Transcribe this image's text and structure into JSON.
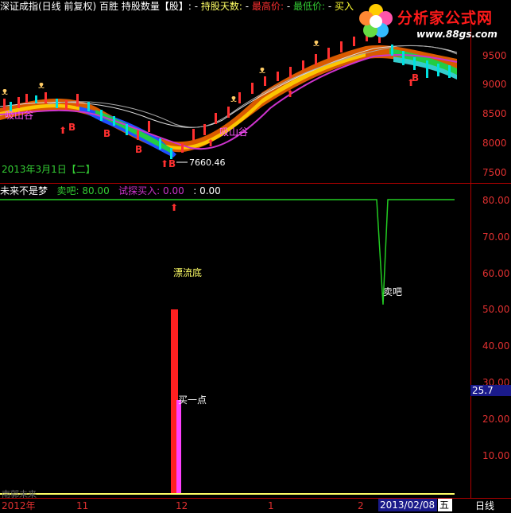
{
  "header": {
    "title": "深证成指(日线 前复权)",
    "badge": "百胜",
    "hold_qty_label": "持股数量【股】:",
    "hold_qty_value": "-",
    "hold_days_label": "持股天数:",
    "hold_days_value": "-",
    "high_label": "最高价:",
    "high_value": "-",
    "low_label": "最低价:",
    "low_value": "-",
    "buy_label": "买入"
  },
  "logo": {
    "title": "分析家公式网",
    "url": "www.88gs.com"
  },
  "panel1": {
    "date_label": "2013年3月1日【二】",
    "price_note": "7660.46",
    "labels": [
      "吸山谷",
      "吸山谷"
    ],
    "marks": [
      "B",
      "B",
      "B",
      "B",
      "B"
    ]
  },
  "panel2": {
    "indicator_name": "未来不是梦",
    "sell_label": "卖吧:",
    "sell_value": "80.00",
    "trial_buy_label": "试探买入:",
    "trial_buy_value": "0.00",
    "third_label": ":",
    "third_value": "0.00",
    "annotation_drift": "漂流底",
    "annotation_sell": "卖吧",
    "annotation_buy": "买一点",
    "footer_text": "南郭未来"
  },
  "right_axis": {
    "upper_ticks": [
      "9500",
      "9000",
      "8500",
      "8000",
      "7500"
    ],
    "lower_ticks": [
      "80.00",
      "70.00",
      "60.00",
      "50.00",
      "40.00",
      "30.00",
      "20.00",
      "10.00"
    ],
    "cursor_value": "25.7"
  },
  "bottom_axis": {
    "labels": [
      "2012年",
      "11",
      "12",
      "1",
      "2"
    ],
    "cursor_date": "2013/02/08",
    "cursor_day": "五",
    "period": "日线"
  },
  "colors": {
    "axis": "#b00000",
    "tick_text": "#e03030",
    "sell_line": "#22cc22",
    "buy_bar": "#ff2020",
    "trial_bar": "#ff40ff",
    "purple": "#cc33cc"
  }
}
